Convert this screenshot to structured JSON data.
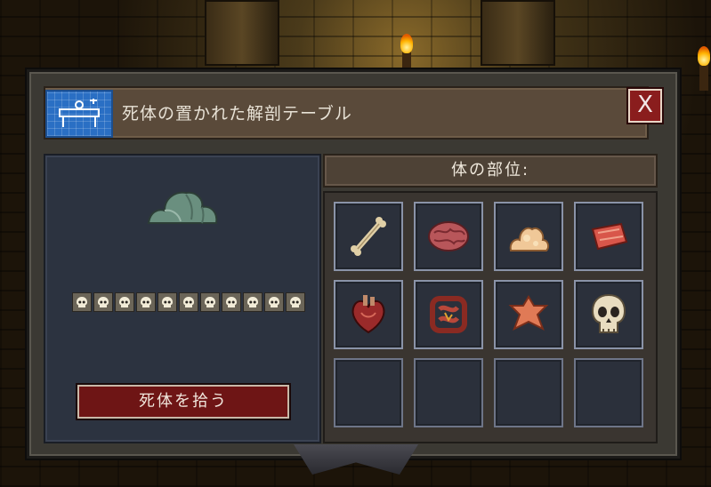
{
  "window": {
    "title": "死体の置かれた解剖テーブル",
    "close_label": "X"
  },
  "left_panel": {
    "corpse_icon": "corpse-mound-icon",
    "skull_count": 11,
    "skull_icon": "skull-icon",
    "pickup_button": "死体を拾う"
  },
  "parts_panel": {
    "header": "体の部位:",
    "slots": [
      {
        "icon": "bone-icon"
      },
      {
        "icon": "brain-icon"
      },
      {
        "icon": "fat-icon"
      },
      {
        "icon": "meat-icon"
      },
      {
        "icon": "heart-icon"
      },
      {
        "icon": "intestines-icon"
      },
      {
        "icon": "skin-icon"
      },
      {
        "icon": "skull-icon"
      },
      {
        "icon": null
      },
      {
        "icon": null
      },
      {
        "icon": null
      },
      {
        "icon": null
      }
    ]
  },
  "colors": {
    "panel": "#3b3933",
    "title_bar": "#5a4a3a",
    "left_panel": "#2c3340",
    "slot_border": "#8a93a8",
    "button_red": "#6e1515",
    "close_red": "#8a1d1d",
    "blueprint": "#2a6fc4"
  }
}
